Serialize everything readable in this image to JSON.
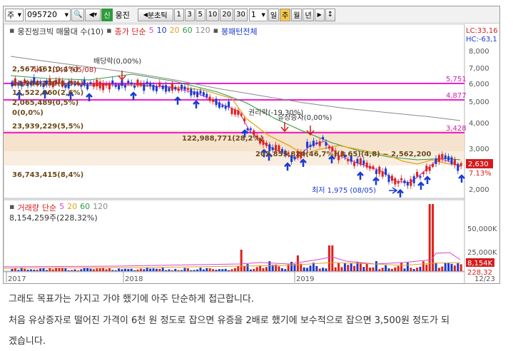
{
  "toolbar": {
    "market": "주",
    "code": "095720",
    "green_tag": "신",
    "stock_short": "웅진",
    "period_label": "분초틱",
    "nums": [
      "1",
      "3",
      "5",
      "10",
      "20",
      "30"
    ],
    "count": "1",
    "day": "일",
    "week": "주",
    "month": "월",
    "year": "년"
  },
  "legend": {
    "name": "웅진씽크빅 매물대 수(10)",
    "ma_label": "종가 단순",
    "ma_periods": [
      "5",
      "10",
      "20",
      "60",
      "120"
    ],
    "pattern": "봉패턴전체"
  },
  "volume_legend": {
    "title": "거래량",
    "ma_label": "단순",
    "ma_periods": [
      "5",
      "20",
      "60",
      "120"
    ],
    "value": "8,154,259주(228,32%)"
  },
  "price_axis": {
    "top_labels": [
      "LC:33,16",
      "HC:-63,1"
    ],
    "ticks": [
      "8,000",
      "7,000",
      "6,000",
      "5,000",
      "4,000",
      "3,000",
      "2,000"
    ],
    "current_price": "2,630",
    "change": "7.13%"
  },
  "volume_axis": {
    "ticks": [
      "50,000K",
      "25,000K"
    ],
    "current": "8,154K",
    "ratio": "228,32"
  },
  "time_axis": {
    "ticks": [
      "2017",
      "2018",
      "2019"
    ],
    "end": "12/23"
  },
  "annotations": {
    "high": "최고 7,142 (05/08)",
    "dividend": "배당락(0,00%)",
    "rights": "권리락(-19,30%)",
    "rights_issue": "유상증자(0,00%)",
    "low": "최저 1,975 (08/05)",
    "hline_5751": "5,751",
    "hline_4877": "4,877",
    "hline_3428": "3,428"
  },
  "volume_profile": [
    "2,567,461(0,4%)",
    "23,954,130(5,5%)",
    "11,522,060(2,6%)",
    "2,065,489(0,5%)",
    "0(0,0%)",
    "23,939,229(5,5%)",
    "122,988,771(28,2%)",
    "203,855,824(46,7%)(3,65)(4,8) ~ 2,562,200",
    "36,743,415(8,4%)"
  ],
  "colors": {
    "candle_up": "#e0201a",
    "candle_down": "#1a3ad0",
    "ma5": "#d946d0",
    "ma20": "#e3a21a",
    "ma60": "#2f9a46",
    "ma120": "#8a8a8a",
    "hline": "#f020d0",
    "accent_red": "#d41c1c"
  },
  "paragraphs": [
    "그래도 목표가는 가지고 가야 했기에 아주 단순하게 접근합니다.",
    "처음 유상증자로 떨어진 가격이 6천 원 정도로 잡으면 유증을 2배로 했기에 보수적으로 잡으면 3,500원 정도가 되",
    "겠습니다."
  ]
}
